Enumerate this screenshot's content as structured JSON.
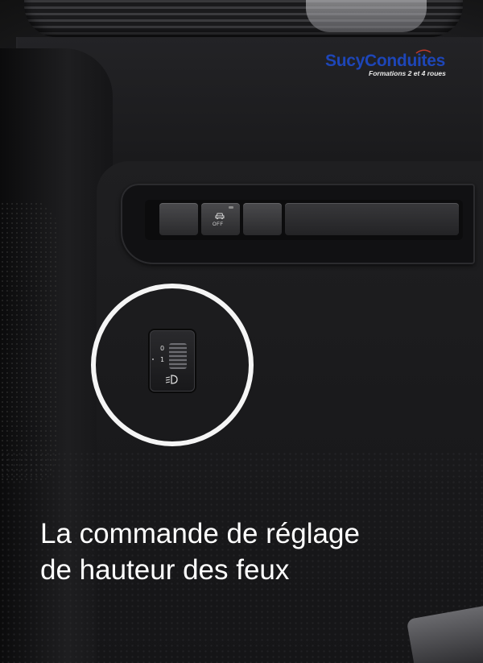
{
  "logo": {
    "brand": "SucyConduites",
    "tagline": "Formations 2 et 4 roues",
    "brand_color": "#1e46b8"
  },
  "caption": {
    "line1": "La commande de réglage",
    "line2": "de hauteur des feux"
  },
  "button_strip": {
    "off_label": "OFF"
  },
  "headlamp_control": {
    "marks": [
      "0",
      "1"
    ],
    "icon": "headlamp-level-icon"
  },
  "highlight": {
    "color": "#f5f5f5"
  }
}
